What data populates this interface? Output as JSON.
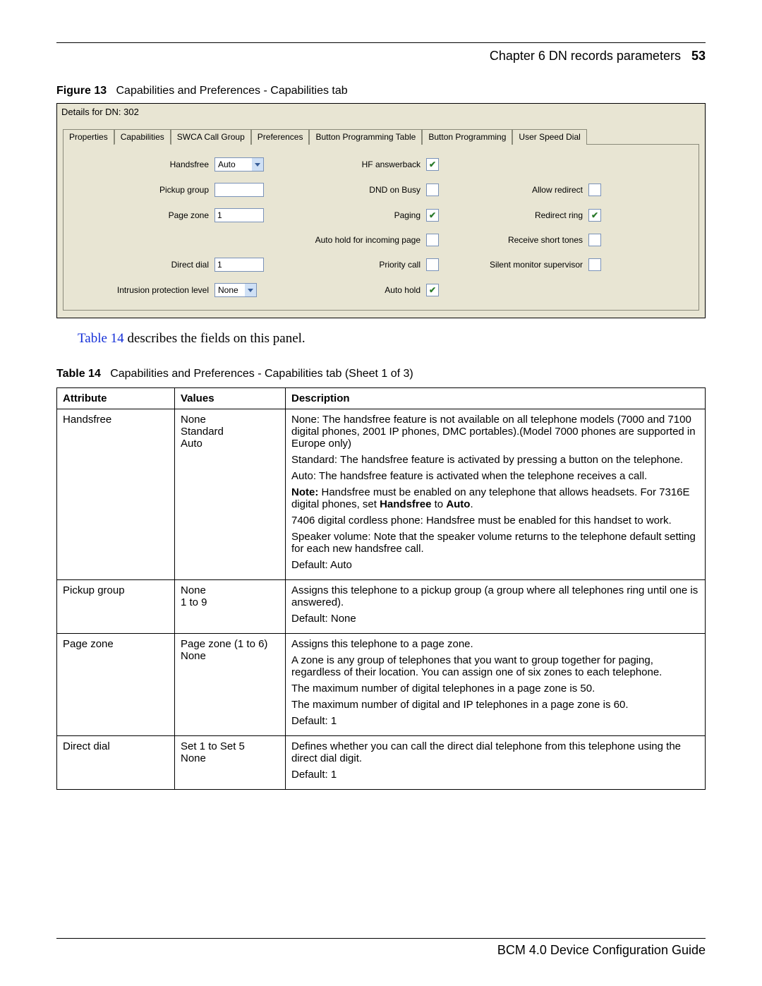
{
  "header": {
    "chapter": "Chapter 6  DN records parameters",
    "page": "53"
  },
  "figure": {
    "label": "Figure 13",
    "caption": "Capabilities and Preferences - Capabilities tab"
  },
  "panel": {
    "title": "Details for DN: 302",
    "tabs": [
      "Properties",
      "Capabilities",
      "SWCA Call Group",
      "Preferences",
      "Button Programming Table",
      "Button Programming",
      "User Speed Dial"
    ],
    "fields": {
      "handsfree": {
        "label": "Handsfree",
        "value": "Auto"
      },
      "pickup_group": {
        "label": "Pickup group",
        "value": ""
      },
      "page_zone": {
        "label": "Page zone",
        "value": "1"
      },
      "direct_dial": {
        "label": "Direct dial",
        "value": "1"
      },
      "intrusion": {
        "label": "Intrusion protection level",
        "value": "None"
      },
      "hf_answerback": {
        "label": "HF answerback",
        "checked": true
      },
      "dnd_busy": {
        "label": "DND on Busy",
        "checked": false
      },
      "paging": {
        "label": "Paging",
        "checked": true
      },
      "auto_hold_incoming": {
        "label": "Auto hold for incoming page",
        "checked": false
      },
      "priority_call": {
        "label": "Priority call",
        "checked": false
      },
      "auto_hold": {
        "label": "Auto hold",
        "checked": true
      },
      "allow_redirect": {
        "label": "Allow redirect",
        "checked": false
      },
      "redirect_ring": {
        "label": "Redirect ring",
        "checked": true
      },
      "receive_short_tones": {
        "label": "Receive short tones",
        "checked": false
      },
      "silent_monitor": {
        "label": "Silent monitor supervisor",
        "checked": false
      }
    }
  },
  "para": {
    "link": "Table 14",
    "rest": " describes the fields on this panel."
  },
  "table": {
    "label": "Table 14",
    "caption": "Capabilities and Preferences - Capabilities tab (Sheet 1 of 3)",
    "headers": {
      "attr": "Attribute",
      "val": "Values",
      "desc": "Description"
    },
    "rows": [
      {
        "attr": "Handsfree",
        "val": "None\nStandard\nAuto",
        "desc": [
          "None: The handsfree feature is not available on all telephone models (7000 and 7100 digital phones, 2001 IP phones, DMC portables).(Model 7000 phones are supported in Europe only)",
          "Standard: The handsfree feature is activated by pressing a button on the telephone.",
          "Auto: The handsfree feature is activated when the telephone receives a call.",
          "<b>Note:</b> Handsfree must be enabled on any telephone that allows headsets. For 7316E digital phones, set <b>Handsfree</b> to <b>Auto</b>.",
          "7406 digital cordless phone: Handsfree must be enabled for this handset to work.",
          "Speaker volume: Note that the speaker volume returns to the telephone default setting for each new handsfree call.",
          "Default: Auto"
        ]
      },
      {
        "attr": "Pickup group",
        "val": "None\n1 to 9",
        "desc": [
          "Assigns this telephone to a pickup group (a group where all telephones ring until one is answered).",
          "Default: None"
        ]
      },
      {
        "attr": "Page zone",
        "val": "Page zone (1 to 6)\nNone",
        "desc": [
          "Assigns this telephone to a page zone.",
          "A zone is any group of telephones that you want to group together for paging, regardless of their location. You can assign one of six zones to each telephone.",
          "The maximum number of digital telephones in a page zone is 50.",
          "The maximum number of digital and IP telephones in a page zone is  60.",
          "Default: 1"
        ]
      },
      {
        "attr": "Direct dial",
        "val": "Set 1 to Set  5\nNone",
        "desc": [
          "Defines whether you can call the direct dial telephone from this telephone using the direct dial digit.",
          "Default: 1"
        ]
      }
    ]
  },
  "footer": "BCM 4.0 Device Configuration Guide"
}
